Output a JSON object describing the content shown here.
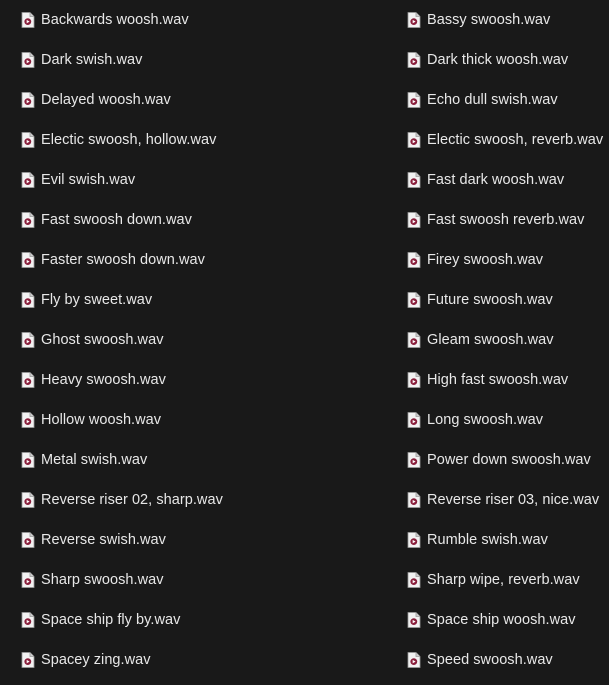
{
  "files": {
    "icon": "wav-audio-file-icon",
    "left": [
      "Backwards woosh.wav",
      "Dark swish.wav",
      "Delayed woosh.wav",
      "Electic swoosh, hollow.wav",
      "Evil swish.wav",
      "Fast swoosh down.wav",
      "Faster swoosh down.wav",
      "Fly by sweet.wav",
      "Ghost swoosh.wav",
      "Heavy swoosh.wav",
      "Hollow woosh.wav",
      "Metal swish.wav",
      "Reverse riser 02, sharp.wav",
      "Reverse swish.wav",
      "Sharp swoosh.wav",
      "Space ship fly by.wav",
      "Spacey zing.wav"
    ],
    "right": [
      "Bassy swoosh.wav",
      "Dark thick woosh.wav",
      "Echo dull swish.wav",
      "Electic swoosh, reverb.wav",
      "Fast dark woosh.wav",
      "Fast swoosh reverb.wav",
      "Firey swoosh.wav",
      "Future swoosh.wav",
      "Gleam swoosh.wav",
      "High fast swoosh.wav",
      "Long swoosh.wav",
      "Power down swoosh.wav",
      "Reverse riser 03, nice.wav",
      "Rumble swish.wav",
      "Sharp wipe, reverb.wav",
      "Space ship woosh.wav",
      "Speed swoosh.wav"
    ]
  },
  "colors": {
    "background": "#191919",
    "text": "#e8e8e8",
    "icon_page": "#f2f2f2",
    "icon_badge": "#8a1f3c"
  }
}
